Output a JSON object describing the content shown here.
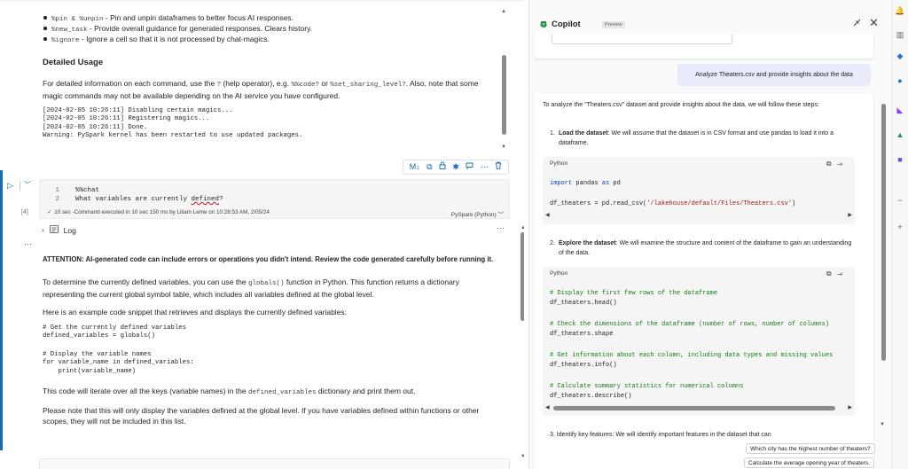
{
  "notebook": {
    "bullets": [
      {
        "cmd": "%pin & %unpin",
        "text": " - Pin and unpin dataframes to better focus AI responses."
      },
      {
        "cmd": "%new_task",
        "text": " - Provide overall guidance for generated responses. Clears history."
      },
      {
        "cmd": "%ignore",
        "text": " - Ignore a cell so that it is not processed by chat-magics."
      }
    ],
    "detailed_heading": "Detailed Usage",
    "detailed_para_a": "For detailed information on each command, use the ",
    "detailed_code_1": "?",
    "detailed_para_b": " (help operator), e.g. ",
    "detailed_code_2": "%%code?",
    "detailed_para_c": " or ",
    "detailed_code_3": "%set_sharing_level?",
    "detailed_para_d": ". Also, note that some magic commands may not be available depending on the AI service you have configured.",
    "log_lines": "[2024-02-05 10:26:11] Disabling certain magics...\n[2024-02-05 10:26:11] Registering magics...\n[2024-02-05 10:26:11] Done.\nWarning: PySpark kernel has been restarted to use updated packages.",
    "cell": {
      "exec_count": "[4]",
      "line1_num": "1",
      "line1": "%%chat",
      "line2_num": "2",
      "line2_a": "What variables are currently ",
      "line2_b": "defined",
      "line2_c": "?",
      "status": "10 sec -Command executed in 10 sec 150 ms by Liliam Leme on 10:28:53 AM, 2/05/24",
      "kernel": "PySpark (Python)"
    },
    "toolbar_icons": [
      "M↓",
      "⧉",
      "🔒",
      "✱",
      "▭",
      "⋯",
      "🗑"
    ],
    "log_label": "Log",
    "attention": "ATTENTION: AI-generated code can include errors or operations you didn't intend. Review the code generated carefully before running it.",
    "answer_p1_a": "To determine the currently defined variables, you can use the ",
    "answer_p1_code": "globals()",
    "answer_p1_b": " function in Python. This function returns a dictionary representing the current global symbol table, which includes all variables defined at the global level.",
    "answer_p2": "Here is an example code snippet that retrieves and displays the currently defined variables:",
    "answer_code_1": "# Get the currently defined variables\ndefined_variables = globals()",
    "answer_code_2": "# Display the variable names\nfor variable_name in defined_variables:\n    print(variable_name)",
    "answer_p3_a": "This code will iterate over all the keys (variable names) in the ",
    "answer_p3_code": "defined_variables",
    "answer_p3_b": " dictionary and print them out.",
    "answer_p4": "Please note that this will only display the variables defined at the global level. If you have variables defined within functions or other scopes, they will not be included in this list."
  },
  "copilot": {
    "title": "Copilot",
    "badge": "Preview",
    "user_message": "Analyze Theaters.csv and provide insights about the data",
    "intro": "To analyze the \"Theaters.csv\" dataset and provide insights about the data, we will follow these steps:",
    "step1_title": "Load the dataset",
    "step1_text": ": We will assume that the dataset is in CSV format and use pandas to load it into a dataframe.",
    "code1_lang": "Python",
    "code1_line1_kw1": "import",
    "code1_line1_mid": " pandas ",
    "code1_line1_kw2": "as",
    "code1_line1_end": " pd",
    "code1_line2_a": "df_theaters = pd.read_csv(",
    "code1_line2_str": "'/lakehouse/default/Files/Theaters.csv'",
    "code1_line2_b": ")",
    "step2_title": "Explore the dataset",
    "step2_text": ": We will examine the structure and content of the dataframe to gain an understanding of the data.",
    "code2_lang": "Python",
    "code2_c1": "# Display the first few rows of the dataframe",
    "code2_l1": "df_theaters.head()",
    "code2_c2": "# Check the dimensions of the dataframe (number of rows, number of columns)",
    "code2_l2": "df_theaters.shape",
    "code2_c3": "# Get information about each column, including data types and missing values",
    "code2_l3": "df_theaters.info()",
    "code2_c4": "# Calculate summary statistics for numerical columns",
    "code2_l4": "df_theaters.describe()",
    "step3_partial": "3. Identify key features: We will identify important features in the dataset that can",
    "suggestions": [
      "Which city has the highest number of theaters?",
      "Calculate the average opening year of theaters."
    ]
  },
  "colors": {
    "accent": "#0f6cbd",
    "user_bubble": "#e8ebfa",
    "code_bg": "#f5f5f5"
  }
}
